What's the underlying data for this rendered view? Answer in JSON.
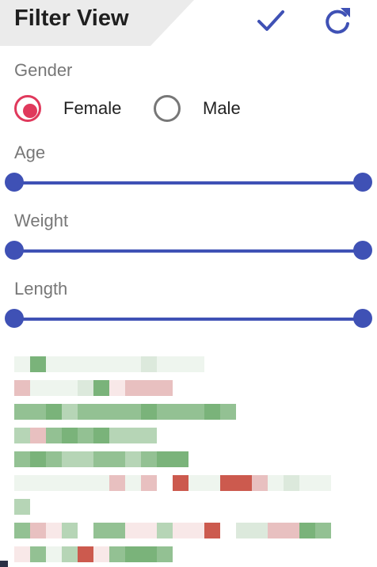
{
  "header": {
    "title": "Filter View",
    "confirm_icon": "check-icon",
    "reset_icon": "refresh-icon"
  },
  "gender": {
    "label": "Gender",
    "options": [
      {
        "label": "Female",
        "selected": true
      },
      {
        "label": "Male",
        "selected": false
      }
    ]
  },
  "sliders": [
    {
      "label": "Age",
      "min": 0,
      "max": 1
    },
    {
      "label": "Weight",
      "min": 0,
      "max": 1
    },
    {
      "label": "Length",
      "min": 0,
      "max": 1
    }
  ],
  "colors": {
    "accent": "#3f51b5",
    "radio_selected": "#e0395c",
    "header_bg": "#ebebeb"
  },
  "heatmap": {
    "rows": [
      [
        "g1",
        "g5",
        "g1",
        "g1",
        "g1",
        "g1",
        "g1",
        "g1",
        "g2",
        "g1",
        "g1",
        "g1"
      ],
      [
        "r2",
        "g1",
        "g1",
        "g1",
        "g2",
        "g5",
        "r1",
        "r2",
        "r2",
        "r2"
      ],
      [
        "g4",
        "g4",
        "g5",
        "g3",
        "g4",
        "g4",
        "g4",
        "g4",
        "g5",
        "g4",
        "g4",
        "g4",
        "g5",
        "g4"
      ],
      [
        "g3",
        "r2",
        "g4",
        "g5",
        "g4",
        "g5",
        "g3",
        "g3",
        "g3"
      ],
      [
        "g4",
        "g5",
        "g4",
        "g3",
        "g3",
        "g4",
        "g4",
        "g3",
        "g4",
        "g5",
        "g5"
      ],
      [
        "g1",
        "g1",
        "g1",
        "g1",
        "g1",
        "g1",
        "r2",
        "g1",
        "r2",
        "w",
        "r5",
        "g1",
        "g1",
        "r5",
        "r5",
        "r2",
        "g1",
        "g2",
        "g1",
        "g1"
      ],
      [
        "g3"
      ],
      [
        "g4",
        "r2",
        "r1",
        "g3",
        "w",
        "g4",
        "g4",
        "r1",
        "r1",
        "g3",
        "r1",
        "r1",
        "r5",
        "w",
        "g2",
        "g2",
        "r2",
        "r2",
        "g5",
        "g4"
      ],
      [
        "r1",
        "g4",
        "g1",
        "g3",
        "r5",
        "r1",
        "g4",
        "g5",
        "g5",
        "g4"
      ]
    ]
  }
}
